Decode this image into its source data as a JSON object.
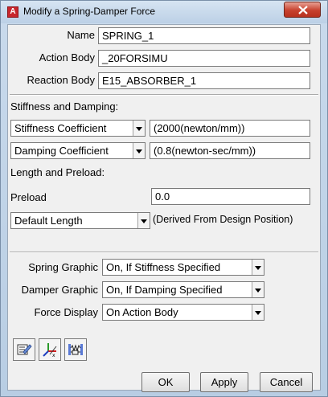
{
  "window": {
    "title": "Modify a Spring-Damper Force",
    "app_icon_letter": "A"
  },
  "form": {
    "name_label": "Name",
    "name_value": "SPRING_1",
    "action_body_label": "Action Body",
    "action_body_value": "_20FORSIMU",
    "reaction_body_label": "Reaction Body",
    "reaction_body_value": "E15_ABSORBER_1"
  },
  "stiffness_section": {
    "heading": "Stiffness and Damping:",
    "stiffness_select": "Stiffness Coefficient",
    "stiffness_value": "(2000(newton/mm))",
    "damping_select": "Damping Coefficient",
    "damping_value": "(0.8(newton-sec/mm))"
  },
  "length_section": {
    "heading": "Length and Preload:",
    "preload_label": "Preload",
    "preload_value": "0.0",
    "length_select": "Default Length",
    "length_note": "(Derived From Design Position)"
  },
  "graphics": {
    "spring_label": "Spring Graphic",
    "spring_value": "On, If Stiffness Specified",
    "damper_label": "Damper Graphic",
    "damper_value": "On, If Damping Specified",
    "force_label": "Force Display",
    "force_value": "On Action Body"
  },
  "buttons": {
    "ok": "OK",
    "apply": "Apply",
    "cancel": "Cancel"
  },
  "icons": [
    "edit-pencil-icon",
    "triad-axes-icon",
    "spring-damper-icon"
  ]
}
